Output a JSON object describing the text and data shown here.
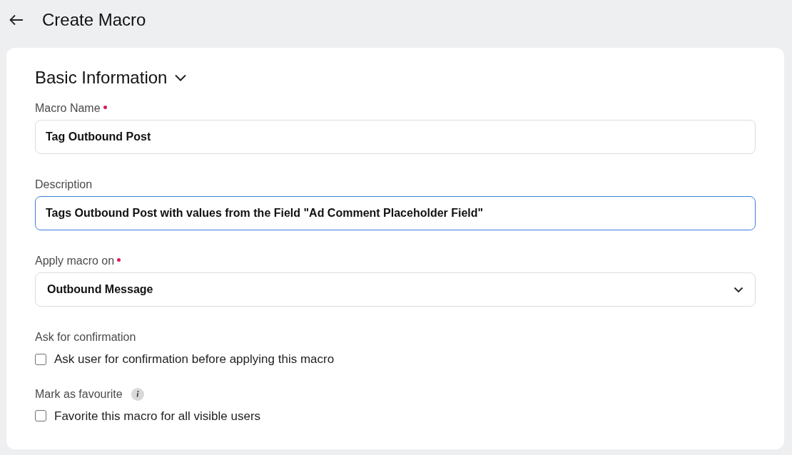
{
  "header": {
    "title": "Create Macro"
  },
  "section": {
    "title": "Basic Information",
    "expanded": true
  },
  "fields": [
    {
      "kind": "text",
      "label": "Macro Name",
      "required": true,
      "value": "Tag Outbound Post",
      "focused": false
    },
    {
      "kind": "text",
      "label": "Description",
      "required": false,
      "value": "Tags Outbound Post with values from the Field \"Ad Comment Placeholder Field\"",
      "focused": true
    },
    {
      "kind": "select",
      "label": "Apply macro on",
      "required": true,
      "value": "Outbound Message",
      "focused": false
    },
    {
      "kind": "checkbox",
      "label": "Ask for confirmation",
      "info": false,
      "option": "Ask user for confirmation before applying this macro",
      "checked": false
    },
    {
      "kind": "checkbox",
      "label": "Mark as favourite",
      "info": true,
      "option": "Favorite this macro for all visible users",
      "checked": false
    }
  ]
}
